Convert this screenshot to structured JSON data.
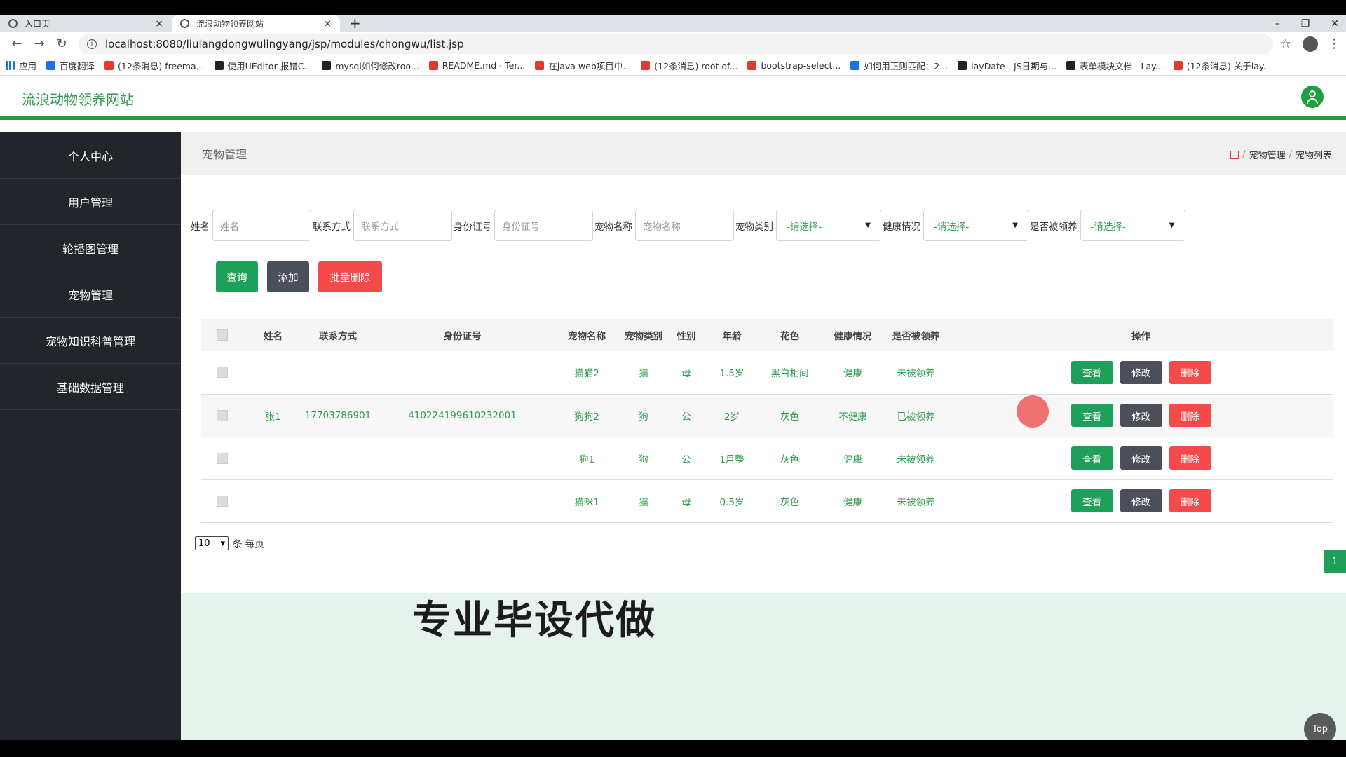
{
  "browser": {
    "tabs": [
      {
        "label": "入口页",
        "close": "×"
      },
      {
        "label": "流浪动物领养网站",
        "close": "×"
      }
    ],
    "new_tab": "+",
    "window_controls": [
      "–",
      "❐",
      "✕"
    ],
    "url": "localhost:8080/liulangdongwulingyang/jsp/modules/chongwu/list.jsp",
    "bookmarks": [
      "应用",
      "百度翻译",
      "(12条消息) freema...",
      "使用UEditor 报错C...",
      "mysql如何修改roo...",
      "README.md · Ter...",
      "在java web项目中...",
      "(12条消息) root of...",
      "bootstrap-select...",
      "如何用正则匹配：2...",
      "layDate - JS日期与...",
      "表单模块文档 - Lay...",
      "(12条消息) 关于lay..."
    ]
  },
  "app": {
    "title": "流浪动物领养网站",
    "accent": "#1fa03e"
  },
  "sidebar": {
    "items": [
      "个人中心",
      "用户管理",
      "轮播图管理",
      "宠物管理",
      "宠物知识科普管理",
      "基础数据管理"
    ]
  },
  "page": {
    "title": "宠物管理",
    "breadcrumb": [
      "宠物管理",
      "宠物列表"
    ]
  },
  "filters": {
    "name_label": "姓名",
    "name_placeholder": "姓名",
    "phone_label": "联系方式",
    "phone_placeholder": "联系方式",
    "id_label": "身份证号",
    "id_placeholder": "身份证号",
    "petname_label": "宠物名称",
    "petname_placeholder": "宠物名称",
    "type_label": "宠物类别",
    "type_value": "-请选择-",
    "health_label": "健康情况",
    "health_value": "-请选择-",
    "adopted_label": "是否被领养",
    "adopted_value": "-请选择-"
  },
  "actions": {
    "query": "查询",
    "add": "添加",
    "batch_delete": "批量删除"
  },
  "table": {
    "headers": [
      "姓名",
      "联系方式",
      "身份证号",
      "宠物名称",
      "宠物类别",
      "性别",
      "年龄",
      "花色",
      "健康情况",
      "是否被领养",
      "操作"
    ],
    "rows": [
      {
        "name": "",
        "phone": "",
        "idno": "",
        "pet": "猫猫2",
        "type": "猫",
        "sex": "母",
        "age": "1.5岁",
        "color": "黑白相间",
        "health": "健康",
        "adopted": "未被领养"
      },
      {
        "name": "张1",
        "phone": "17703786901",
        "idno": "410224199610232001",
        "pet": "狗狗2",
        "type": "狗",
        "sex": "公",
        "age": "2岁",
        "color": "灰色",
        "health": "不健康",
        "adopted": "已被领养"
      },
      {
        "name": "",
        "phone": "",
        "idno": "",
        "pet": "狗1",
        "type": "狗",
        "sex": "公",
        "age": "1月整",
        "color": "灰色",
        "health": "健康",
        "adopted": "未被领养"
      },
      {
        "name": "",
        "phone": "",
        "idno": "",
        "pet": "猫咪1",
        "type": "猫",
        "sex": "母",
        "age": "0.5岁",
        "color": "灰色",
        "health": "健康",
        "adopted": "未被领养"
      }
    ],
    "row_buttons": {
      "view": "查看",
      "edit": "修改",
      "delete": "删除"
    }
  },
  "pager": {
    "page_size": "10",
    "suffix": "条 每页",
    "current_page": "1"
  },
  "overlay": {
    "watermark": "专业毕设代做",
    "top_button": "Top"
  }
}
